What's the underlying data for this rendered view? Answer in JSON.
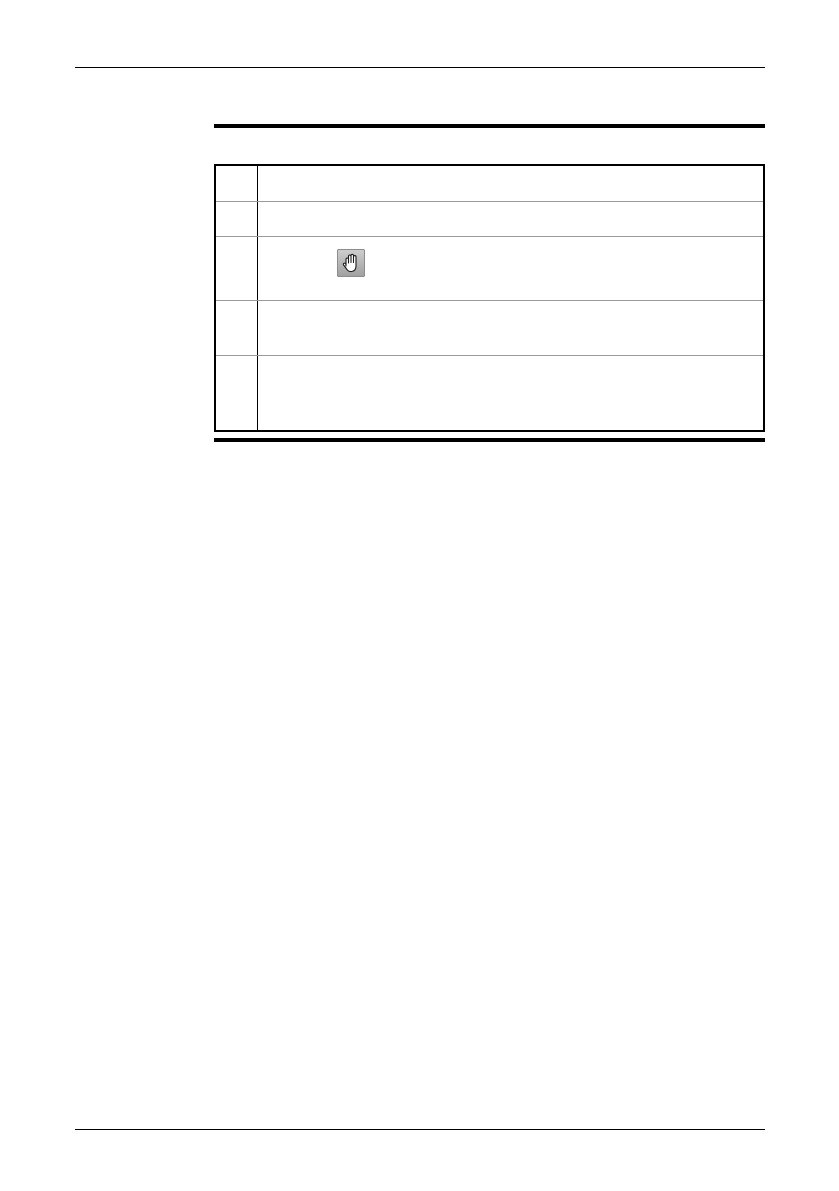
{
  "steps": [
    {
      "number": "",
      "text": "",
      "icon": null
    },
    {
      "number": "",
      "text": "",
      "icon": null
    },
    {
      "number": "",
      "text": "",
      "icon": "hand-pan-icon"
    },
    {
      "number": "",
      "text": "",
      "icon": null
    },
    {
      "number": "",
      "text": "",
      "icon": null
    }
  ],
  "colors": {
    "rule": "#000000",
    "row_divider": "#9a9a9a",
    "icon_background": "#b5b5b5"
  }
}
